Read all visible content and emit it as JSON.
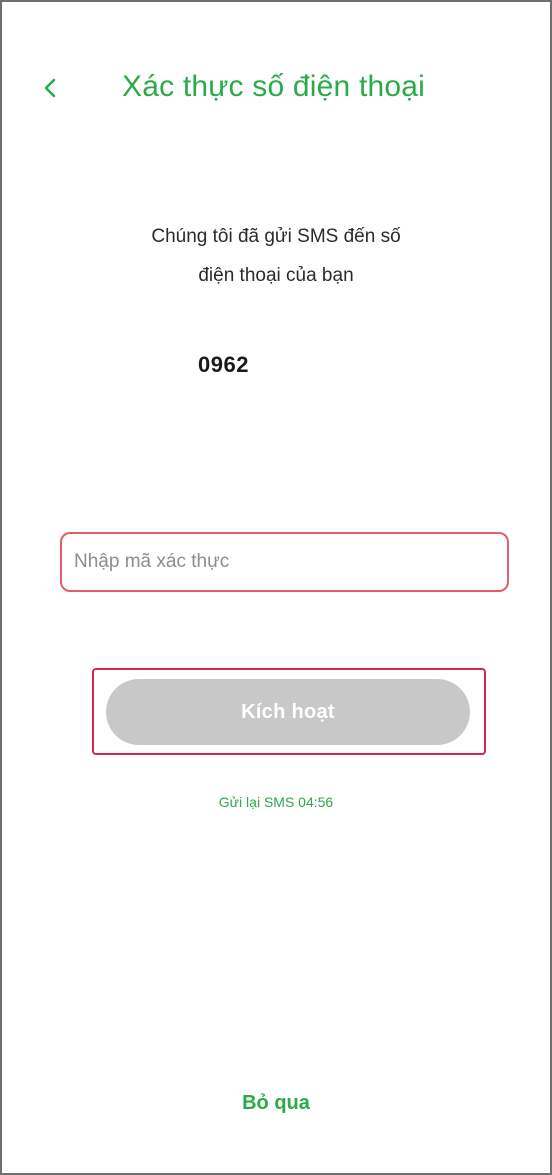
{
  "header": {
    "title": "Xác thực số điện thoại",
    "back_icon": "chevron-left-icon"
  },
  "message": {
    "line1": "Chúng tôi đã gửi SMS đến số",
    "line2": "điện thoại của bạn"
  },
  "phone_number": "0962",
  "verification": {
    "placeholder": "Nhập mã xác thực",
    "value": ""
  },
  "actions": {
    "activate_label": "Kích hoạt",
    "resend_label": "Gửi lại SMS 04:56",
    "skip_label": "Bỏ qua"
  },
  "colors": {
    "accent": "#2aaa48",
    "disabled_button": "#c8c8c8",
    "highlight_border": "#d7284b"
  }
}
